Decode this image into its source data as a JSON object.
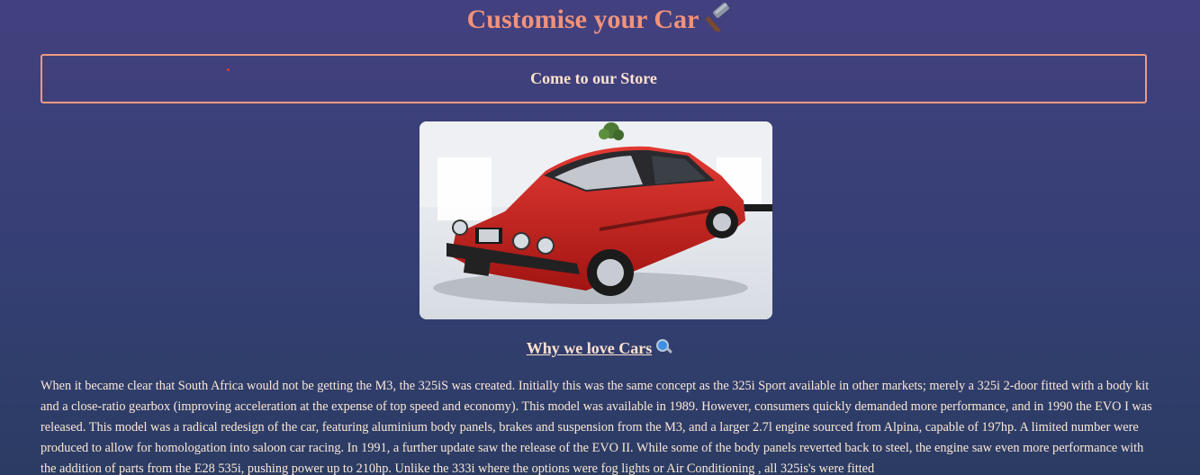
{
  "page": {
    "title": "Customise your Car",
    "title_icon": "hammer-icon"
  },
  "store_button": {
    "label": "Come to our Store"
  },
  "hero": {
    "image": "red-bmw-325is-coupe-photo"
  },
  "section": {
    "heading": "Why we love Cars",
    "heading_icon": "magnifying-glass-icon"
  },
  "article": {
    "text": "When it became clear that South Africa would not be getting the M3, the 325iS was created. Initially this was the same concept as the 325i Sport available in other markets; merely a 325i 2-door fitted with a body kit and a close-ratio gearbox (improving acceleration at the expense of top speed and economy). This model was available in 1989. However, consumers quickly demanded more performance, and in 1990 the EVO I was released. This model was a radical redesign of the car, featuring aluminium body panels, brakes and suspension from the M3, and a larger 2.7l engine sourced from Alpina, capable of 197hp. A limited number were produced to allow for homologation into saloon car racing. In 1991, a further update saw the release of the EVO II. While some of the body panels reverted back to steel, the engine saw even more performance with the addition of parts from the E28 535i, pushing power up to 210hp. Unlike the 333i where the options were fog lights or Air Conditioning , all 325is's were fitted"
  },
  "colors": {
    "title": "#f1927a",
    "button_border": "#ef9a82",
    "text": "#fbe7d6",
    "background_top": "#43407f",
    "background_bottom": "#2b3c63"
  }
}
